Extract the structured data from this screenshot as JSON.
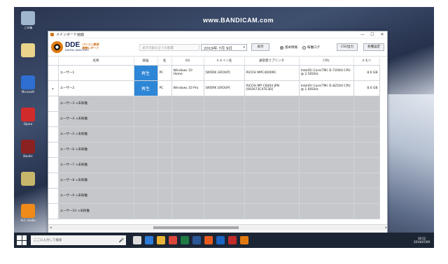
{
  "watermark": "www.BANDICAM.com",
  "desktop_icons": [
    {
      "label": "ごみ箱",
      "color": "#9fb6cf"
    },
    {
      "label": "",
      "color": "#e9d48a"
    },
    {
      "label": "Microsoft",
      "color": "#2f6fd1"
    },
    {
      "label": "Opera",
      "color": "#d12b2b"
    },
    {
      "label": "Bandic",
      "color": "#8a2222"
    },
    {
      "label": "",
      "color": "#c8b76a"
    },
    {
      "label": "VLC media",
      "color": "#f08a18"
    }
  ],
  "window": {
    "title": "メインボード画面",
    "minimize": "—",
    "maximize": "☐",
    "close": "✕"
  },
  "logo": {
    "name": "DDE",
    "subtitle": "DIGITAL DATA EYES",
    "tagline_1": "パソコン管理",
    "tagline_2": "稼働レポート"
  },
  "toolbar": {
    "dept_placeholder": "表示可能な全ての部署",
    "date_value": "2019年 7月 9日",
    "dropdown_glyph": "▾",
    "show_label": "表示",
    "radio_basic": "基本情報",
    "radio_log": "稼働ログ",
    "csv_label": "CSV出力",
    "settings_label": "各種設定"
  },
  "table": {
    "headers": [
      "名称",
      "録画",
      "名",
      "OS",
      "ドメイン名",
      "通常使うプリンタ",
      "CPU",
      "メモリ"
    ],
    "rows": [
      {
        "marker": "",
        "name": "ユーザー1",
        "record": "再生",
        "pc": "PC",
        "os": "Windows 10 Home",
        "domain": "[WORK GROUP]",
        "printer": "RICOH MPC4000RC",
        "cpu": "Intel(R) Core(TM) i5-7200U CPU @ 2.50GHz",
        "memory": "8.0 GB",
        "active": true
      },
      {
        "marker": "▸",
        "name": "ユーザー2",
        "record": "再生",
        "pc": "PC",
        "os": "Windows 10 Pro",
        "domain": "[WORK GROUP]",
        "printer": "RICOH MP C6004 JPN [002673C07E3D]",
        "cpu": "Intel(R) Core(TM) i5-8250U CPU @ 1.60GHz",
        "memory": "8.0 GB",
        "active": true
      },
      {
        "marker": "",
        "name": "ユーザー3 ×未稼働",
        "record": "",
        "pc": "",
        "os": "",
        "domain": "",
        "printer": "",
        "cpu": "",
        "memory": "",
        "active": false
      },
      {
        "marker": "",
        "name": "ユーザー4 ×未稼働",
        "record": "",
        "pc": "",
        "os": "",
        "domain": "",
        "printer": "",
        "cpu": "",
        "memory": "",
        "active": false
      },
      {
        "marker": "",
        "name": "ユーザー5 ×未稼働",
        "record": "",
        "pc": "",
        "os": "",
        "domain": "",
        "printer": "",
        "cpu": "",
        "memory": "",
        "active": false
      },
      {
        "marker": "",
        "name": "ユーザー6 ×未稼働",
        "record": "",
        "pc": "",
        "os": "",
        "domain": "",
        "printer": "",
        "cpu": "",
        "memory": "",
        "active": false
      },
      {
        "marker": "",
        "name": "ユーザー7 ×未稼働",
        "record": "",
        "pc": "",
        "os": "",
        "domain": "",
        "printer": "",
        "cpu": "",
        "memory": "",
        "active": false
      },
      {
        "marker": "",
        "name": "ユーザー8 ×未稼働",
        "record": "",
        "pc": "",
        "os": "",
        "domain": "",
        "printer": "",
        "cpu": "",
        "memory": "",
        "active": false
      },
      {
        "marker": "",
        "name": "ユーザー9 ×未稼働",
        "record": "",
        "pc": "",
        "os": "",
        "domain": "",
        "printer": "",
        "cpu": "",
        "memory": "",
        "active": false
      },
      {
        "marker": "",
        "name": "ユーザー10 ×未稼働",
        "record": "",
        "pc": "",
        "os": "",
        "domain": "",
        "printer": "",
        "cpu": "",
        "memory": "",
        "active": false
      }
    ]
  },
  "scrollbar": {
    "left": "◂",
    "right": "▸"
  },
  "taskbar": {
    "search_placeholder": "ここに入力して検索",
    "mic": "🎤",
    "apps": [
      {
        "name": "task-view",
        "color": "#dddddd"
      },
      {
        "name": "edge",
        "color": "#2d7bd6"
      },
      {
        "name": "explorer",
        "color": "#e7b437"
      },
      {
        "name": "chrome",
        "color": "#d8473a"
      },
      {
        "name": "excel",
        "color": "#1f7a44"
      },
      {
        "name": "word",
        "color": "#2b5797"
      },
      {
        "name": "firefox",
        "color": "#e55b1f"
      },
      {
        "name": "outlook",
        "color": "#1b64c2"
      },
      {
        "name": "bandicam",
        "color": "#c22b2b"
      },
      {
        "name": "dde",
        "color": "#e07a10"
      }
    ],
    "time": "18:12",
    "date": "2019/07/09"
  }
}
